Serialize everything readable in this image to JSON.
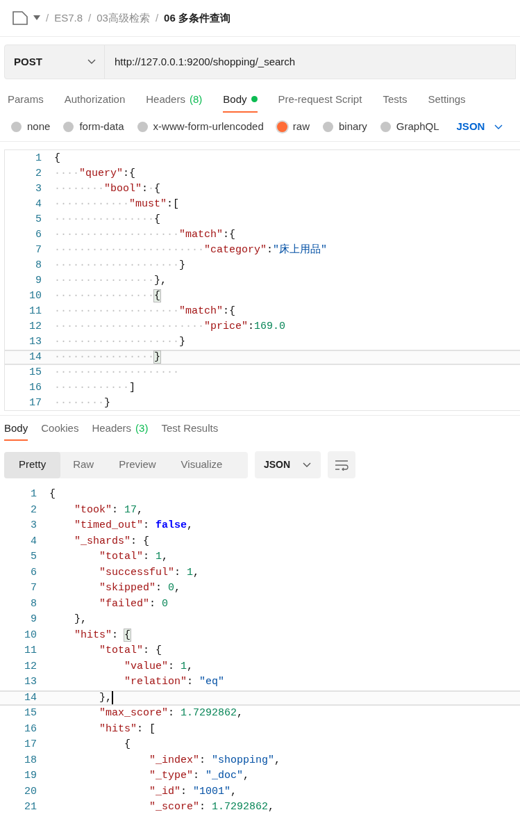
{
  "breadcrumb": [
    {
      "text": "ES7.8",
      "separator": "/",
      "selected": false
    },
    {
      "text": "03高级检索",
      "separator": "/",
      "selected": false
    },
    {
      "text": "06 多条件查询",
      "separator": "/",
      "selected": true
    }
  ],
  "request": {
    "method": "POST",
    "url": "http://127.0.0.1:9200/shopping/_search"
  },
  "request_tabs": [
    {
      "label": "Params",
      "selected": false
    },
    {
      "label": "Authorization",
      "selected": false
    },
    {
      "label": "Headers",
      "count": "(8)",
      "selected": false
    },
    {
      "label": "Body",
      "dot": true,
      "selected": true
    },
    {
      "label": "Pre-request Script",
      "selected": false
    },
    {
      "label": "Tests",
      "selected": false
    },
    {
      "label": "Settings",
      "selected": false
    }
  ],
  "body_types": [
    {
      "label": "none",
      "selected": false
    },
    {
      "label": "form-data",
      "selected": false
    },
    {
      "label": "x-www-form-urlencoded",
      "selected": false
    },
    {
      "label": "raw",
      "selected": true
    },
    {
      "label": "binary",
      "selected": false
    },
    {
      "label": "GraphQL",
      "selected": false
    }
  ],
  "body_language": "JSON",
  "request_editor": {
    "lines": [
      {
        "number": "1",
        "current": false,
        "tokens": [
          {
            "kind": "punct",
            "text": "{"
          }
        ]
      },
      {
        "number": "2",
        "current": false,
        "tokens": [
          {
            "kind": "dots",
            "text": "····"
          },
          {
            "kind": "key",
            "text": "\"query\""
          },
          {
            "kind": "punct",
            "text": ":{"
          }
        ]
      },
      {
        "number": "3",
        "current": false,
        "tokens": [
          {
            "kind": "dots",
            "text": "········"
          },
          {
            "kind": "key",
            "text": "\"bool\""
          },
          {
            "kind": "punct",
            "text": ":"
          },
          {
            "kind": "dots",
            "text": "·"
          },
          {
            "kind": "punct",
            "text": "{"
          }
        ]
      },
      {
        "number": "4",
        "current": false,
        "tokens": [
          {
            "kind": "dots",
            "text": "············"
          },
          {
            "kind": "key",
            "text": "\"must\""
          },
          {
            "kind": "punct",
            "text": ":["
          }
        ]
      },
      {
        "number": "5",
        "current": false,
        "tokens": [
          {
            "kind": "dots",
            "text": "················"
          },
          {
            "kind": "punct",
            "text": "{"
          }
        ]
      },
      {
        "number": "6",
        "current": false,
        "tokens": [
          {
            "kind": "dots",
            "text": "····················"
          },
          {
            "kind": "key",
            "text": "\"match\""
          },
          {
            "kind": "punct",
            "text": ":{"
          }
        ]
      },
      {
        "number": "7",
        "current": false,
        "tokens": [
          {
            "kind": "dots",
            "text": "························"
          },
          {
            "kind": "key",
            "text": "\"category\""
          },
          {
            "kind": "punct",
            "text": ":"
          },
          {
            "kind": "string",
            "text": "\"床上用品\""
          }
        ]
      },
      {
        "number": "8",
        "current": false,
        "tokens": [
          {
            "kind": "dots",
            "text": "····················"
          },
          {
            "kind": "punct",
            "text": "}"
          }
        ]
      },
      {
        "number": "9",
        "current": false,
        "tokens": [
          {
            "kind": "dots",
            "text": "················"
          },
          {
            "kind": "punct",
            "text": "},"
          }
        ]
      },
      {
        "number": "10",
        "current": false,
        "tokens": [
          {
            "kind": "dots",
            "text": "················"
          },
          {
            "kind": "matched",
            "text": "{"
          }
        ]
      },
      {
        "number": "11",
        "current": false,
        "tokens": [
          {
            "kind": "dots",
            "text": "····················"
          },
          {
            "kind": "key",
            "text": "\"match\""
          },
          {
            "kind": "punct",
            "text": ":{"
          }
        ]
      },
      {
        "number": "12",
        "current": false,
        "tokens": [
          {
            "kind": "dots",
            "text": "························"
          },
          {
            "kind": "key",
            "text": "\"price\""
          },
          {
            "kind": "punct",
            "text": ":"
          },
          {
            "kind": "number",
            "text": "169.0"
          }
        ]
      },
      {
        "number": "13",
        "current": false,
        "tokens": [
          {
            "kind": "dots",
            "text": "····················"
          },
          {
            "kind": "punct",
            "text": "}"
          }
        ]
      },
      {
        "number": "14",
        "current": true,
        "tokens": [
          {
            "kind": "dots",
            "text": "················"
          },
          {
            "kind": "matched",
            "text": "}"
          }
        ]
      },
      {
        "number": "15",
        "current": false,
        "tokens": [
          {
            "kind": "dots",
            "text": "····················"
          }
        ]
      },
      {
        "number": "16",
        "current": false,
        "tokens": [
          {
            "kind": "dots",
            "text": "············"
          },
          {
            "kind": "punct",
            "text": "]"
          }
        ]
      },
      {
        "number": "17",
        "current": false,
        "tokens": [
          {
            "kind": "dots",
            "text": "········"
          },
          {
            "kind": "punct",
            "text": "}"
          }
        ]
      }
    ]
  },
  "response_tabs": [
    {
      "label": "Body",
      "selected": true
    },
    {
      "label": "Cookies",
      "selected": false
    },
    {
      "label": "Headers",
      "count": "(3)",
      "selected": false
    },
    {
      "label": "Test Results",
      "selected": false
    }
  ],
  "view_modes": [
    {
      "label": "Pretty",
      "selected": true
    },
    {
      "label": "Raw",
      "selected": false
    },
    {
      "label": "Preview",
      "selected": false
    },
    {
      "label": "Visualize",
      "selected": false
    }
  ],
  "response_format": "JSON",
  "response_editor": {
    "lines": [
      {
        "number": "1",
        "current": false,
        "cursor": false,
        "tokens": [
          {
            "kind": "punct",
            "text": "{"
          }
        ]
      },
      {
        "number": "2",
        "current": false,
        "cursor": false,
        "tokens": [
          {
            "kind": "key",
            "text": "    \"took\""
          },
          {
            "kind": "punct",
            "text": ": "
          },
          {
            "kind": "number",
            "text": "17"
          },
          {
            "kind": "punct",
            "text": ","
          }
        ]
      },
      {
        "number": "3",
        "current": false,
        "cursor": false,
        "tokens": [
          {
            "kind": "key",
            "text": "    \"timed_out\""
          },
          {
            "kind": "punct",
            "text": ": "
          },
          {
            "kind": "bool",
            "text": "false"
          },
          {
            "kind": "punct",
            "text": ","
          }
        ]
      },
      {
        "number": "4",
        "current": false,
        "cursor": false,
        "tokens": [
          {
            "kind": "key",
            "text": "    \"_shards\""
          },
          {
            "kind": "punct",
            "text": ": {"
          }
        ]
      },
      {
        "number": "5",
        "current": false,
        "cursor": false,
        "tokens": [
          {
            "kind": "key",
            "text": "        \"total\""
          },
          {
            "kind": "punct",
            "text": ": "
          },
          {
            "kind": "number",
            "text": "1"
          },
          {
            "kind": "punct",
            "text": ","
          }
        ]
      },
      {
        "number": "6",
        "current": false,
        "cursor": false,
        "tokens": [
          {
            "kind": "key",
            "text": "        \"successful\""
          },
          {
            "kind": "punct",
            "text": ": "
          },
          {
            "kind": "number",
            "text": "1"
          },
          {
            "kind": "punct",
            "text": ","
          }
        ]
      },
      {
        "number": "7",
        "current": false,
        "cursor": false,
        "tokens": [
          {
            "kind": "key",
            "text": "        \"skipped\""
          },
          {
            "kind": "punct",
            "text": ": "
          },
          {
            "kind": "number",
            "text": "0"
          },
          {
            "kind": "punct",
            "text": ","
          }
        ]
      },
      {
        "number": "8",
        "current": false,
        "cursor": false,
        "tokens": [
          {
            "kind": "key",
            "text": "        \"failed\""
          },
          {
            "kind": "punct",
            "text": ": "
          },
          {
            "kind": "number",
            "text": "0"
          }
        ]
      },
      {
        "number": "9",
        "current": false,
        "cursor": false,
        "tokens": [
          {
            "kind": "punct",
            "text": "    },"
          }
        ]
      },
      {
        "number": "10",
        "current": false,
        "cursor": false,
        "tokens": [
          {
            "kind": "key",
            "text": "    \"hits\""
          },
          {
            "kind": "punct",
            "text": ": "
          },
          {
            "kind": "matched",
            "text": "{"
          }
        ]
      },
      {
        "number": "11",
        "current": false,
        "cursor": false,
        "tokens": [
          {
            "kind": "key",
            "text": "        \"total\""
          },
          {
            "kind": "punct",
            "text": ": {"
          }
        ]
      },
      {
        "number": "12",
        "current": false,
        "cursor": false,
        "tokens": [
          {
            "kind": "key",
            "text": "            \"value\""
          },
          {
            "kind": "punct",
            "text": ": "
          },
          {
            "kind": "number",
            "text": "1"
          },
          {
            "kind": "punct",
            "text": ","
          }
        ]
      },
      {
        "number": "13",
        "current": false,
        "cursor": false,
        "tokens": [
          {
            "kind": "key",
            "text": "            \"relation\""
          },
          {
            "kind": "punct",
            "text": ": "
          },
          {
            "kind": "string",
            "text": "\"eq\""
          }
        ]
      },
      {
        "number": "14",
        "current": true,
        "cursor": true,
        "tokens": [
          {
            "kind": "punct",
            "text": "        },"
          }
        ]
      },
      {
        "number": "15",
        "current": false,
        "cursor": false,
        "tokens": [
          {
            "kind": "key",
            "text": "        \"max_score\""
          },
          {
            "kind": "punct",
            "text": ": "
          },
          {
            "kind": "number",
            "text": "1.7292862"
          },
          {
            "kind": "punct",
            "text": ","
          }
        ]
      },
      {
        "number": "16",
        "current": false,
        "cursor": false,
        "tokens": [
          {
            "kind": "key",
            "text": "        \"hits\""
          },
          {
            "kind": "punct",
            "text": ": ["
          }
        ]
      },
      {
        "number": "17",
        "current": false,
        "cursor": false,
        "tokens": [
          {
            "kind": "punct",
            "text": "            {"
          }
        ]
      },
      {
        "number": "18",
        "current": false,
        "cursor": false,
        "tokens": [
          {
            "kind": "key",
            "text": "                \"_index\""
          },
          {
            "kind": "punct",
            "text": ": "
          },
          {
            "kind": "string",
            "text": "\"shopping\""
          },
          {
            "kind": "punct",
            "text": ","
          }
        ]
      },
      {
        "number": "19",
        "current": false,
        "cursor": false,
        "tokens": [
          {
            "kind": "key",
            "text": "                \"_type\""
          },
          {
            "kind": "punct",
            "text": ": "
          },
          {
            "kind": "string",
            "text": "\"_doc\""
          },
          {
            "kind": "punct",
            "text": ","
          }
        ]
      },
      {
        "number": "20",
        "current": false,
        "cursor": false,
        "tokens": [
          {
            "kind": "key",
            "text": "                \"_id\""
          },
          {
            "kind": "punct",
            "text": ": "
          },
          {
            "kind": "string",
            "text": "\"1001\""
          },
          {
            "kind": "punct",
            "text": ","
          }
        ]
      },
      {
        "number": "21",
        "current": false,
        "cursor": false,
        "tokens": [
          {
            "kind": "key",
            "text": "                \"_score\""
          },
          {
            "kind": "punct",
            "text": ": "
          },
          {
            "kind": "number",
            "text": "1.7292862"
          },
          {
            "kind": "punct",
            "text": ","
          }
        ]
      }
    ]
  }
}
